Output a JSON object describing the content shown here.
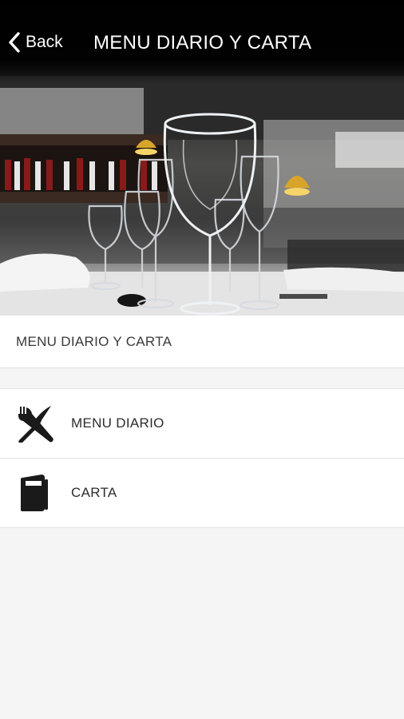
{
  "header": {
    "back_label": "Back",
    "title": "MENU DIARIO Y CARTA"
  },
  "hero": {
    "image_subject": "restaurant-table-wine-glasses-photo"
  },
  "section": {
    "heading": "MENU DIARIO Y CARTA"
  },
  "menu": {
    "items": [
      {
        "label": "MENU DIARIO",
        "icon": "fork-knife-icon"
      },
      {
        "label": "CARTA",
        "icon": "menu-book-icon"
      }
    ]
  },
  "colors": {
    "header_bg": "#000000",
    "header_text": "#ffffff",
    "page_bg": "#f5f5f5",
    "card_bg": "#ffffff",
    "divider": "#e2e2e2",
    "text": "#2c2c2c",
    "icon": "#1a1a1a"
  }
}
